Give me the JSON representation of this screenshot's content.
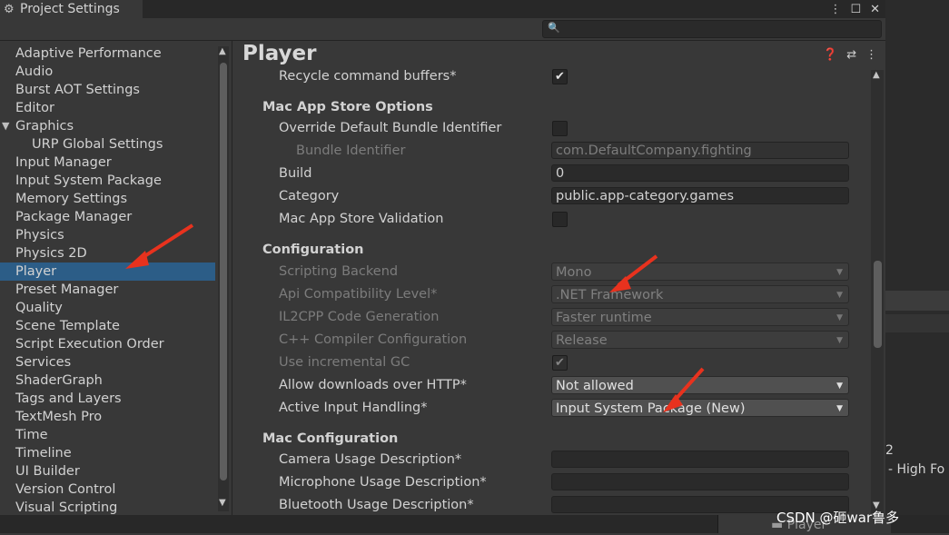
{
  "window": {
    "title": "Project Settings",
    "title_icon": "gear-icon",
    "controls": [
      "⋮",
      "☐",
      "✕"
    ]
  },
  "search": {
    "placeholder": "",
    "icon": "search-icon"
  },
  "sidebar": {
    "items": [
      {
        "label": "Adaptive Performance"
      },
      {
        "label": "Audio"
      },
      {
        "label": "Burst AOT Settings"
      },
      {
        "label": "Editor"
      },
      {
        "label": "Graphics",
        "expanded": true
      },
      {
        "label": "URP Global Settings",
        "indent": true
      },
      {
        "label": "Input Manager"
      },
      {
        "label": "Input System Package"
      },
      {
        "label": "Memory Settings"
      },
      {
        "label": "Package Manager"
      },
      {
        "label": "Physics"
      },
      {
        "label": "Physics 2D"
      },
      {
        "label": "Player",
        "selected": true
      },
      {
        "label": "Preset Manager"
      },
      {
        "label": "Quality"
      },
      {
        "label": "Scene Template"
      },
      {
        "label": "Script Execution Order"
      },
      {
        "label": "Services"
      },
      {
        "label": "ShaderGraph"
      },
      {
        "label": "Tags and Layers"
      },
      {
        "label": "TextMesh Pro"
      },
      {
        "label": "Time"
      },
      {
        "label": "Timeline"
      },
      {
        "label": "UI Builder"
      },
      {
        "label": "Version Control"
      },
      {
        "label": "Visual Scripting"
      }
    ]
  },
  "main": {
    "title": "Player",
    "header_icons": [
      "help-icon",
      "preset-icon",
      "more-icon"
    ],
    "recycle": {
      "label": "Recycle command buffers*",
      "checked": true
    },
    "mac_app_store": {
      "header": "Mac App Store Options",
      "override_label": "Override Default Bundle Identifier",
      "override_checked": false,
      "bundle_label": "Bundle Identifier",
      "bundle_value": "com.DefaultCompany.fighting",
      "build_label": "Build",
      "build_value": "0",
      "category_label": "Category",
      "category_value": "public.app-category.games",
      "validation_label": "Mac App Store Validation",
      "validation_checked": false
    },
    "configuration": {
      "header": "Configuration",
      "scripting_backend_label": "Scripting Backend",
      "scripting_backend_value": "Mono",
      "api_label": "Api Compatibility Level*",
      "api_value": ".NET Framework",
      "il2cpp_label": "IL2CPP Code Generation",
      "il2cpp_value": "Faster runtime",
      "cpp_label": "C++ Compiler Configuration",
      "cpp_value": "Release",
      "incremental_label": "Use incremental GC",
      "incremental_checked": true,
      "http_label": "Allow downloads over HTTP*",
      "http_value": "Not allowed",
      "input_label": "Active Input Handling*",
      "input_value": "Input System Package (New)"
    },
    "mac_configuration": {
      "header": "Mac Configuration",
      "camera_label": "Camera Usage Description*",
      "camera_value": "",
      "microphone_label": "Microphone Usage Description*",
      "microphone_value": "",
      "bluetooth_label": "Bluetooth Usage Description*",
      "bluetooth_value": ""
    }
  },
  "background": {
    "right_text_1": "2",
    "right_text_2": "- High Fo",
    "bottom_tab": "Player",
    "bottom_tab_icon": "folder-icon"
  },
  "watermark": "CSDN @砸war鲁多",
  "colors": {
    "selection": "#2c5d87",
    "annotation_arrow": "#e8321e",
    "panel_bg": "#383838"
  }
}
